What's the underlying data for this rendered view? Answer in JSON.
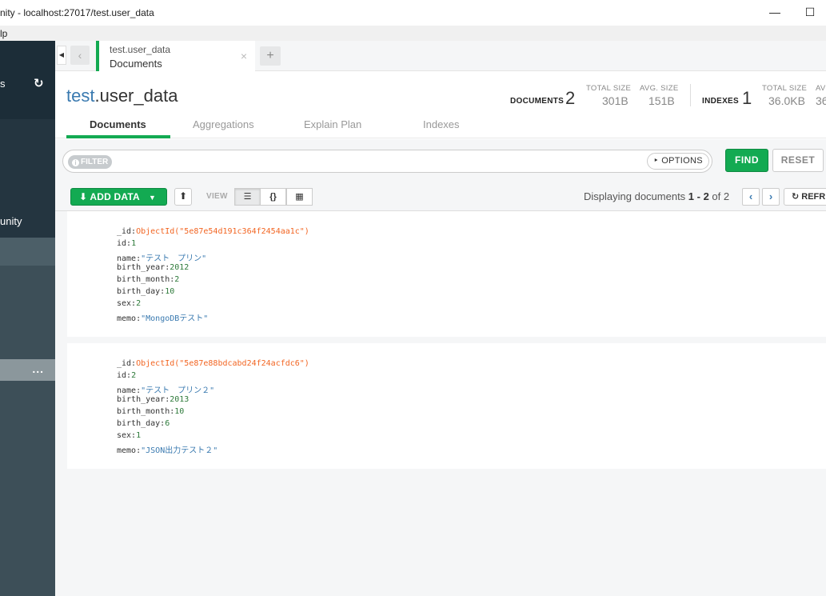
{
  "window": {
    "title": "nity - localhost:27017/test.user_data",
    "minimize": "—",
    "maximize": "☐"
  },
  "menubar": {
    "partial_item": "lp"
  },
  "sidebar": {
    "top_letter": "s",
    "refresh_icon": "↻",
    "dark_text": "unity",
    "active_dots": "..."
  },
  "tabs": {
    "nav_back": "‹",
    "current": {
      "line1": "test.user_data",
      "line2": "Documents",
      "close": "×"
    },
    "new_tab": "+"
  },
  "header": {
    "db": "test",
    "collection": ".user_data",
    "documents_label": "DOCUMENTS",
    "documents_count": "2",
    "total_size_label": "TOTAL SIZE",
    "total_size": "301B",
    "avg_size_label": "AVG. SIZE",
    "avg_size": "151B",
    "indexes_label": "INDEXES",
    "indexes_count": "1",
    "idx_total_size_label": "TOTAL SIZE",
    "idx_total_size": "36.0KB",
    "idx_avg_label": "AV",
    "idx_avg": "36",
    "subtabs": [
      "Documents",
      "Aggregations",
      "Explain Plan",
      "Indexes"
    ]
  },
  "query": {
    "filter_label": "FILTER",
    "filter_placeholder": "",
    "options_label": "OPTIONS",
    "find_label": "FIND",
    "reset_label": "RESET"
  },
  "actions": {
    "add_data_label": "ADD DATA",
    "view_label": "VIEW",
    "view_list": "☰",
    "view_json": "{}",
    "view_table": "▦",
    "displaying_prefix": "Displaying documents ",
    "range": "1 - 2",
    "of": " of 2",
    "refresh_label": "REFR"
  },
  "documents": [
    {
      "fields": [
        {
          "key": "_id",
          "value": "ObjectId(\"5e87e54d191c364f2454aa1c\")",
          "type": "oid"
        },
        {
          "key": "id",
          "value": "1",
          "type": "num"
        },
        {
          "key": "name",
          "value": "\"テスト　プリン\"",
          "type": "str"
        },
        {
          "key": "birth_year",
          "value": "2012",
          "type": "num"
        },
        {
          "key": "birth_month",
          "value": "2",
          "type": "num"
        },
        {
          "key": "birth_day",
          "value": "10",
          "type": "num"
        },
        {
          "key": "sex",
          "value": "2",
          "type": "num"
        },
        {
          "key": "memo",
          "value": "\"MongoDBテスト\"",
          "type": "str"
        }
      ]
    },
    {
      "fields": [
        {
          "key": "_id",
          "value": "ObjectId(\"5e87e88bdcabd24f24acfdc6\")",
          "type": "oid"
        },
        {
          "key": "id",
          "value": "2",
          "type": "num"
        },
        {
          "key": "name",
          "value": "\"テスト　プリン２\"",
          "type": "str"
        },
        {
          "key": "birth_year",
          "value": "2013",
          "type": "num"
        },
        {
          "key": "birth_month",
          "value": "10",
          "type": "num"
        },
        {
          "key": "birth_day",
          "value": "6",
          "type": "num"
        },
        {
          "key": "sex",
          "value": "1",
          "type": "num"
        },
        {
          "key": "memo",
          "value": "\"JSON出力テスト２\"",
          "type": "str"
        }
      ]
    }
  ],
  "colors": {
    "accent_green": "#13aa52",
    "sidebar": "#3d4f58",
    "db_blue": "#3a7ab0",
    "oid_orange": "#f26522"
  }
}
